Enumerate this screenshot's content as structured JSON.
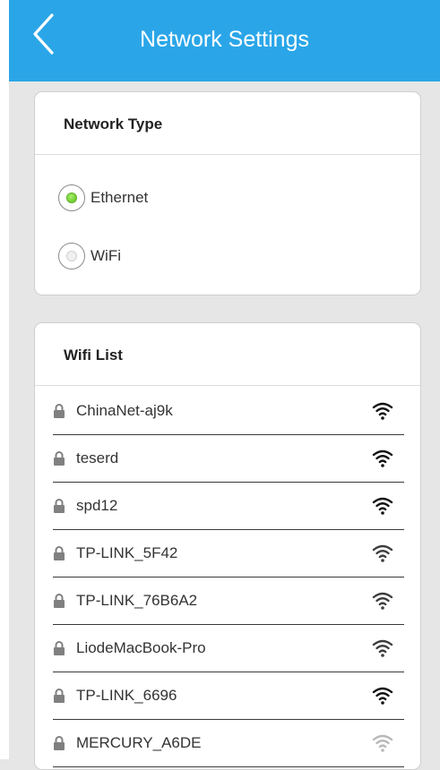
{
  "header": {
    "title": "Network Settings",
    "background": "#2aa6e8"
  },
  "network_type": {
    "title": "Network Type",
    "options": [
      {
        "label": "Ethernet",
        "selected": true
      },
      {
        "label": "WiFi",
        "selected": false
      }
    ]
  },
  "wifi_list": {
    "title": "Wifi List",
    "networks": [
      {
        "ssid": "ChinaNet-aj9k",
        "locked": true,
        "signal": "strong"
      },
      {
        "ssid": "teserd",
        "locked": true,
        "signal": "strong"
      },
      {
        "ssid": "spd12",
        "locked": true,
        "signal": "strong"
      },
      {
        "ssid": "TP-LINK_5F42",
        "locked": true,
        "signal": "medium"
      },
      {
        "ssid": "TP-LINK_76B6A2",
        "locked": true,
        "signal": "medium"
      },
      {
        "ssid": "LiodeMacBook-Pro",
        "locked": true,
        "signal": "medium"
      },
      {
        "ssid": "TP-LINK_6696",
        "locked": true,
        "signal": "strong"
      },
      {
        "ssid": "MERCURY_A6DE",
        "locked": true,
        "signal": "weak"
      }
    ]
  }
}
